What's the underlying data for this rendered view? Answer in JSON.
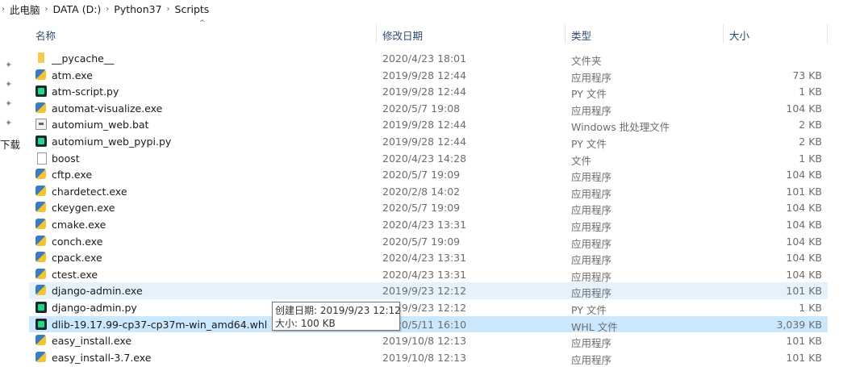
{
  "breadcrumb": [
    "此电脑",
    "DATA (D:)",
    "Python37",
    "Scripts"
  ],
  "columns": {
    "name": "名称",
    "date": "修改日期",
    "type": "类型",
    "size": "大小"
  },
  "sidebar": {
    "downloads_label": "下载"
  },
  "files": [
    {
      "name": "__pycache__",
      "date": "2020/4/23 18:01",
      "type": "文件夹",
      "size": "",
      "icon": "folder-icon"
    },
    {
      "name": "atm.exe",
      "date": "2019/9/28 12:44",
      "type": "应用程序",
      "size": "73 KB",
      "icon": "exe-icon"
    },
    {
      "name": "atm-script.py",
      "date": "2019/9/28 12:44",
      "type": "PY 文件",
      "size": "1 KB",
      "icon": "pycharm-icon"
    },
    {
      "name": "automat-visualize.exe",
      "date": "2020/5/7 19:08",
      "type": "应用程序",
      "size": "104 KB",
      "icon": "exe-icon"
    },
    {
      "name": "automium_web.bat",
      "date": "2019/9/28 12:44",
      "type": "Windows 批处理文件",
      "size": "2 KB",
      "icon": "bat-icon"
    },
    {
      "name": "automium_web_pypi.py",
      "date": "2019/9/28 12:44",
      "type": "PY 文件",
      "size": "2 KB",
      "icon": "pycharm-icon"
    },
    {
      "name": "boost",
      "date": "2020/4/23 14:28",
      "type": "文件",
      "size": "1 KB",
      "icon": "file-icon"
    },
    {
      "name": "cftp.exe",
      "date": "2020/5/7 19:09",
      "type": "应用程序",
      "size": "104 KB",
      "icon": "exe-icon"
    },
    {
      "name": "chardetect.exe",
      "date": "2020/2/8 14:02",
      "type": "应用程序",
      "size": "101 KB",
      "icon": "exe-icon"
    },
    {
      "name": "ckeygen.exe",
      "date": "2020/5/7 19:09",
      "type": "应用程序",
      "size": "104 KB",
      "icon": "exe-icon"
    },
    {
      "name": "cmake.exe",
      "date": "2020/4/23 13:31",
      "type": "应用程序",
      "size": "104 KB",
      "icon": "exe-icon"
    },
    {
      "name": "conch.exe",
      "date": "2020/5/7 19:09",
      "type": "应用程序",
      "size": "104 KB",
      "icon": "exe-icon"
    },
    {
      "name": "cpack.exe",
      "date": "2020/4/23 13:31",
      "type": "应用程序",
      "size": "104 KB",
      "icon": "exe-icon"
    },
    {
      "name": "ctest.exe",
      "date": "2020/4/23 13:31",
      "type": "应用程序",
      "size": "104 KB",
      "icon": "exe-icon"
    },
    {
      "name": "django-admin.exe",
      "date": "2019/9/23 12:12",
      "type": "应用程序",
      "size": "101 KB",
      "icon": "exe-icon",
      "state": "hover"
    },
    {
      "name": "django-admin.py",
      "date": "2019/9/23 12:12",
      "type": "PY 文件",
      "size": "1 KB",
      "icon": "pycharm-icon"
    },
    {
      "name": "dlib-19.17.99-cp37-cp37m-win_amd64.whl",
      "date": "2020/5/11 16:10",
      "type": "WHL 文件",
      "size": "3,039 KB",
      "icon": "pycharm-icon",
      "state": "selected"
    },
    {
      "name": "easy_install.exe",
      "date": "2019/10/8 12:13",
      "type": "应用程序",
      "size": "101 KB",
      "icon": "exe-icon"
    },
    {
      "name": "easy_install-3.7.exe",
      "date": "2019/10/8 12:13",
      "type": "应用程序",
      "size": "101 KB",
      "icon": "exe-icon"
    }
  ],
  "tooltip": {
    "created": "创建日期: 2019/9/23 12:12",
    "size": "大小: 100 KB"
  }
}
